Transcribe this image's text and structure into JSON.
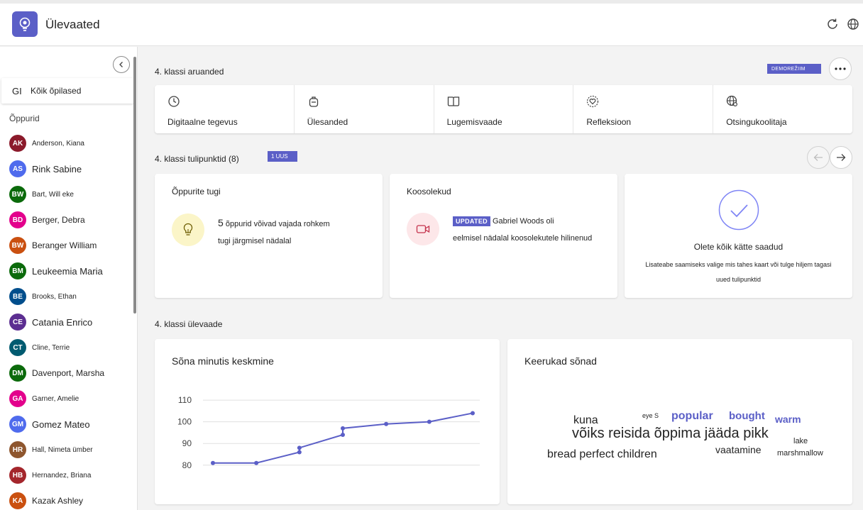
{
  "app": {
    "title": "Ülevaated"
  },
  "sidebar": {
    "all_students_initials": "GI",
    "all_students_label": "Kõik õpilased",
    "section_label": "Õppurid",
    "students": [
      {
        "initials": "AK",
        "name": "Anderson, Kiana",
        "color": "#8b1a2b",
        "size": "sm"
      },
      {
        "initials": "AS",
        "name": "Rink Sabine",
        "color": "#4f6bed",
        "size": "lg"
      },
      {
        "initials": "BW",
        "name": "Bart, Will eke",
        "color": "#0b6a0b",
        "size": "sm"
      },
      {
        "initials": "BD",
        "name": "Berger, Debra",
        "color": "#e3008c",
        "size": "md"
      },
      {
        "initials": "BW",
        "name": "Beranger William",
        "color": "#ca5010",
        "size": "md"
      },
      {
        "initials": "BM",
        "name": "Leukeemia Maria",
        "color": "#0b6a0b",
        "size": "lg"
      },
      {
        "initials": "BE",
        "name": "Brooks, Ethan",
        "color": "#004e8c",
        "size": "sm"
      },
      {
        "initials": "CE",
        "name": "Catania Enrico",
        "color": "#5c2e91",
        "size": "lg"
      },
      {
        "initials": "CT",
        "name": "Cline, Terrie",
        "color": "#005b70",
        "size": "sm"
      },
      {
        "initials": "DM",
        "name": "Davenport, Marsha",
        "color": "#0b6a0b",
        "size": "md"
      },
      {
        "initials": "GA",
        "name": "Garner, Amelie",
        "color": "#e3008c",
        "size": "sm"
      },
      {
        "initials": "GM",
        "name": "Gomez Mateo",
        "color": "#4f6bed",
        "size": "lg"
      },
      {
        "initials": "HR",
        "name": "Hall, Nimeta ümber",
        "color": "#8e562e",
        "size": "sm"
      },
      {
        "initials": "HB",
        "name": "Hernandez, Briana",
        "color": "#a4262c",
        "size": "sm"
      },
      {
        "initials": "KA",
        "name": "Kazak Ashley",
        "color": "#ca5010",
        "size": "md"
      }
    ]
  },
  "reports": {
    "title": "4. klassi aruanded",
    "demo_label": "DEMOREŽIIM",
    "items": [
      {
        "label": "Digitaalne tegevus",
        "icon": "clock-icon"
      },
      {
        "label": "Ülesanded",
        "icon": "backpack-icon"
      },
      {
        "label": "Lugemisvaade",
        "icon": "book-icon"
      },
      {
        "label": "Refleksioon",
        "icon": "heart-icon"
      },
      {
        "label": "Otsingukoolitaja",
        "icon": "globe-search-icon"
      }
    ]
  },
  "highlights": {
    "title": "4. klassi tulipunktid (8)",
    "new_badge": "1 UUS",
    "support": {
      "title": "Õppurite tugi",
      "count": "5",
      "text": "õppurid võivad vajada rohkem",
      "text2": "tugi järgmisel nädalal"
    },
    "meetings": {
      "title": "Koosolekud",
      "tag": "UPDATED",
      "text": "Gabriel Woods oli",
      "text2": "eelmisel nädalal koosolekutele hilinenud"
    },
    "done": {
      "title": "Olete kõik kätte saadud",
      "line1": "Lisateabe saamiseks valige mis tahes kaart või tulge hiljem tagasi",
      "line2": "uued tulipunktid"
    }
  },
  "overview": {
    "title": "4. klassi ülevaade",
    "wpm_title": "Sõna minutis keskmine",
    "words_title": "Keerukad sõnad",
    "words": [
      {
        "text": "kuna",
        "size": 16,
        "color": "#242424",
        "bold": false
      },
      {
        "text": "eye S",
        "size": 9,
        "color": "#242424",
        "bold": false
      },
      {
        "text": "popular",
        "size": 16,
        "color": "#5b5fc7",
        "bold": true
      },
      {
        "text": "bought",
        "size": 15,
        "color": "#5b5fc7",
        "bold": true
      },
      {
        "text": "warm",
        "size": 14,
        "color": "#5b5fc7",
        "bold": true
      },
      {
        "text": "võiks reisida õppima jääda pikk",
        "size": 20,
        "color": "#242424",
        "bold": false
      },
      {
        "text": "lake",
        "size": 11,
        "color": "#242424",
        "bold": false
      },
      {
        "text": "bread perfect children",
        "size": 16,
        "color": "#242424",
        "bold": false
      },
      {
        "text": "vaatamine",
        "size": 14,
        "color": "#242424",
        "bold": false
      },
      {
        "text": "marshmallow",
        "size": 11,
        "color": "#242424",
        "bold": false
      }
    ]
  },
  "chart_data": {
    "type": "line",
    "title": "Sõna minutis keskmine",
    "y_ticks": [
      80,
      90,
      100,
      110
    ],
    "ylim": [
      76,
      112
    ],
    "grid": true,
    "series": [
      {
        "values": [
          81,
          81,
          86,
          88,
          94,
          97,
          99,
          100,
          104
        ]
      }
    ],
    "color": "#5b5fc7"
  }
}
